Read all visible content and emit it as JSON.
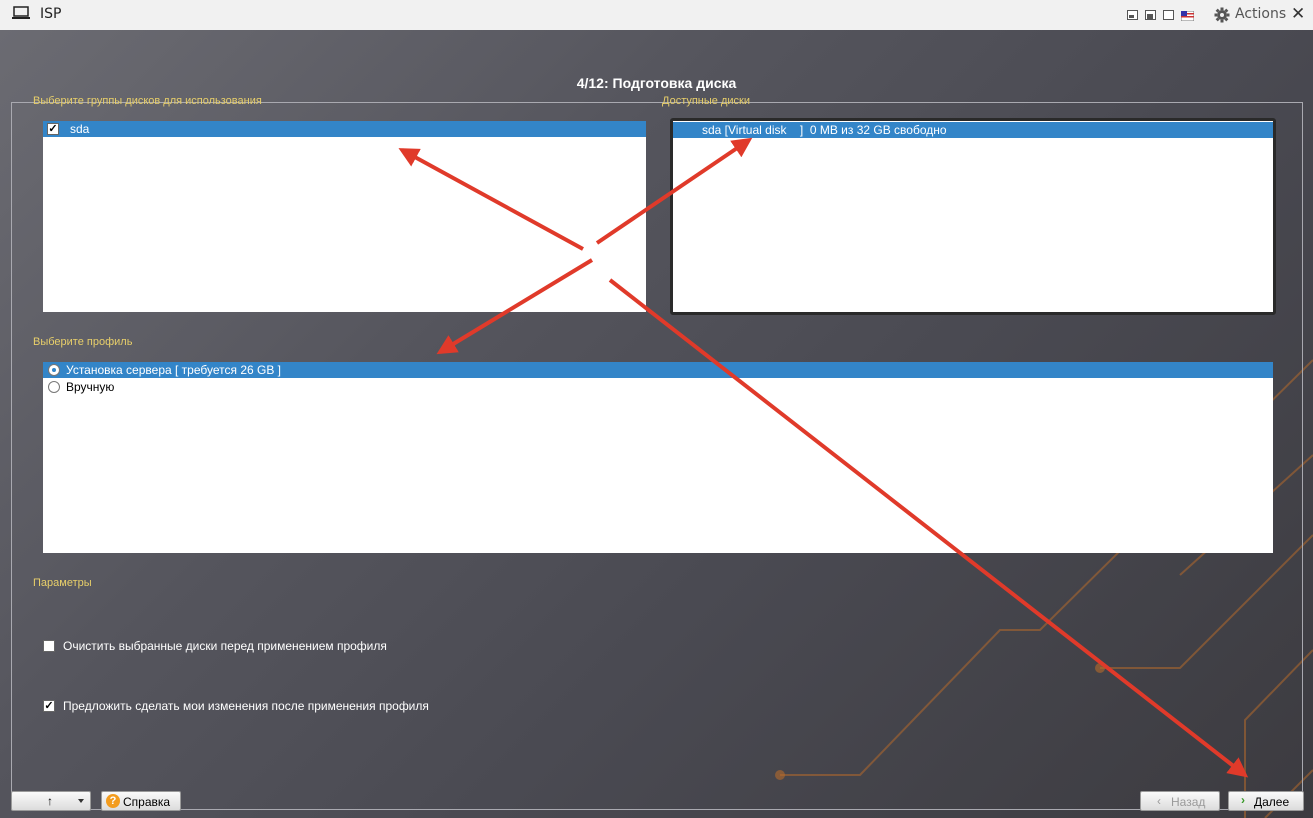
{
  "window": {
    "title": "ISP",
    "actions_label": "Actions",
    "close_glyph": "✕",
    "app_icon": "laptop-icon"
  },
  "wizard": {
    "step_title": "4/12: Подготовка диска",
    "disk_groups": {
      "label": "Выберите группы дисков для использования",
      "items": [
        {
          "name": "sda",
          "checked": true
        }
      ]
    },
    "available_disks": {
      "label": "Доступные диски",
      "items": [
        {
          "text": "sda [Virtual disk    ]  0 MB из 32 GB свободно"
        }
      ]
    },
    "profile": {
      "label": "Выберите профиль",
      "options": [
        {
          "text": "Установка сервера [ требуется 26 GB ]",
          "selected": true
        },
        {
          "text": "Вручную",
          "selected": false
        }
      ]
    },
    "params": {
      "label": "Параметры",
      "options": [
        {
          "text": "Очистить выбранные диски перед применением профиля",
          "checked": false
        },
        {
          "text": "Предложить сделать мои изменения после применения профиля",
          "checked": true
        }
      ]
    }
  },
  "footer": {
    "up_glyph": "↑",
    "help_label": "Справка",
    "back_label": "Назад",
    "next_label": "Далее"
  },
  "colors": {
    "accent": "#3385c8",
    "section_label": "#e8cf6a",
    "annotation_arrow": "#e03a2a"
  }
}
